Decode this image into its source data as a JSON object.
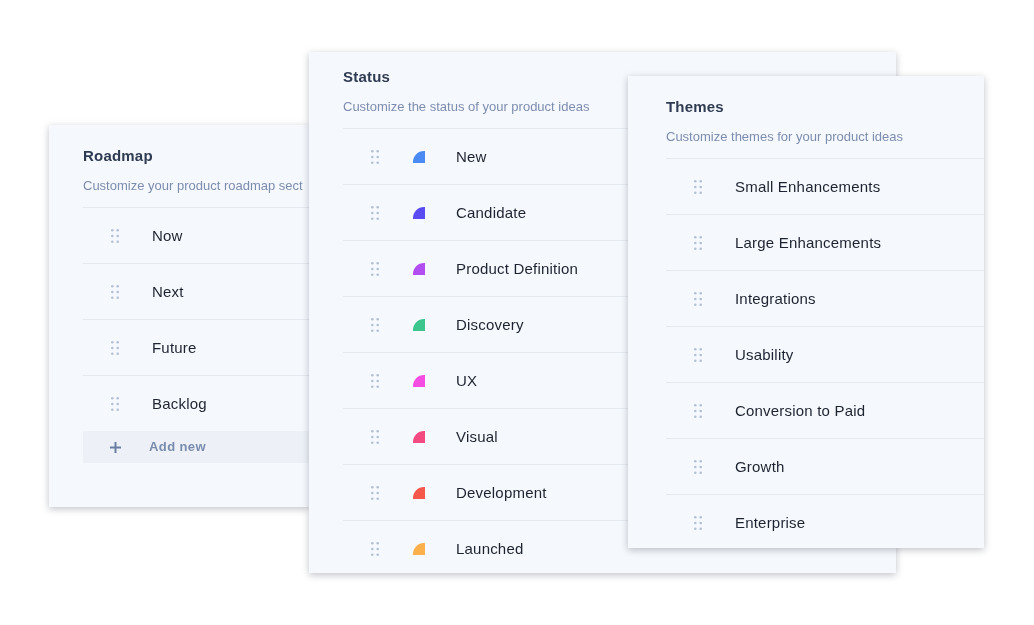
{
  "panels": [
    {
      "title": "Roadmap",
      "subtitle": "Customize your product roadmap sect",
      "items": [
        {
          "label": "Now"
        },
        {
          "label": "Next"
        },
        {
          "label": "Future"
        },
        {
          "label": "Backlog"
        }
      ],
      "add_button": "Add new"
    },
    {
      "title": "Status",
      "subtitle": "Customize the status of your product ideas",
      "items": [
        {
          "label": "New",
          "color": "#4a8af5"
        },
        {
          "label": "Candidate",
          "color": "#5a4cf2"
        },
        {
          "label": "Product Definition",
          "color": "#b24df2"
        },
        {
          "label": "Discovery",
          "color": "#3cc68d"
        },
        {
          "label": "UX",
          "color": "#f54ce4"
        },
        {
          "label": "Visual",
          "color": "#f44a82"
        },
        {
          "label": "Development",
          "color": "#f5574a"
        },
        {
          "label": "Launched",
          "color": "#fbb04c"
        }
      ]
    },
    {
      "title": "Themes",
      "subtitle": "Customize themes for your product ideas",
      "items": [
        {
          "label": "Small Enhancements"
        },
        {
          "label": "Large Enhancements"
        },
        {
          "label": "Integrations"
        },
        {
          "label": "Usability"
        },
        {
          "label": "Conversion to Paid"
        },
        {
          "label": "Growth"
        },
        {
          "label": "Enterprise"
        }
      ]
    }
  ]
}
